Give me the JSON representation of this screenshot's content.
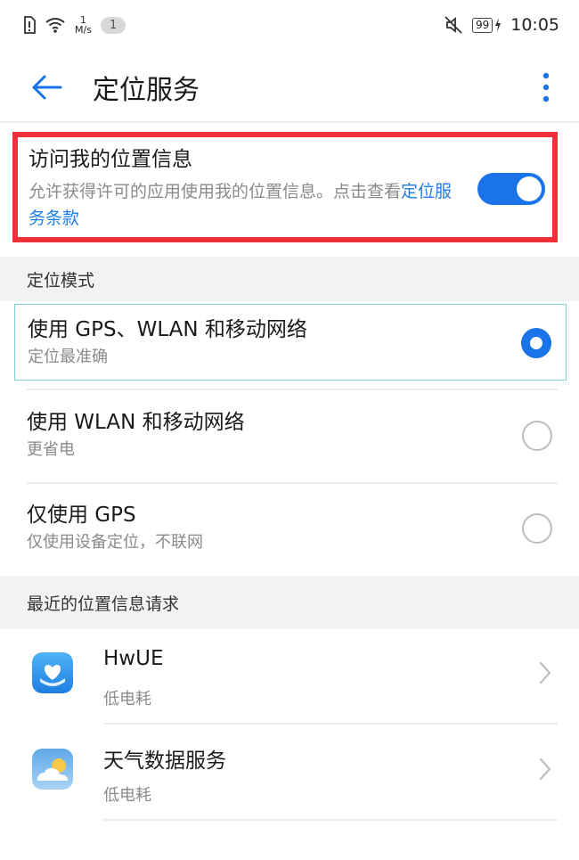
{
  "status_bar": {
    "network_speed_value": "1",
    "network_speed_unit": "M/s",
    "notification_count": "1",
    "battery": "99",
    "time": "10:05"
  },
  "app_bar": {
    "title": "定位服务"
  },
  "access": {
    "title": "访问我的位置信息",
    "description": "允许获得许可的应用使用我的位置信息。点击查看",
    "link": "定位服务条款",
    "toggle_on": true
  },
  "mode_section": {
    "header": "定位模式",
    "options": [
      {
        "title": "使用 GPS、WLAN 和移动网络",
        "subtitle": "定位最准确",
        "selected": true
      },
      {
        "title": "使用 WLAN 和移动网络",
        "subtitle": "更省电",
        "selected": false
      },
      {
        "title": "仅使用 GPS",
        "subtitle": "仅使用设备定位，不联网",
        "selected": false
      }
    ]
  },
  "recent_section": {
    "header": "最近的位置信息请求",
    "apps": [
      {
        "name": "HwUE",
        "subtitle": "低电耗",
        "icon": "hwue-app-icon"
      },
      {
        "name": "天气数据服务",
        "subtitle": "低电耗",
        "icon": "weather-app-icon"
      }
    ]
  },
  "colors": {
    "accent": "#1a73e8",
    "link": "#1e7ee6",
    "highlight_border": "#f0303a"
  }
}
